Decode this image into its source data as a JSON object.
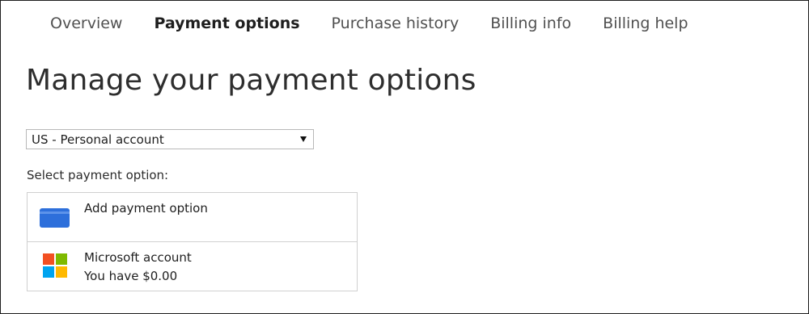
{
  "nav": {
    "tabs": [
      {
        "label": "Overview",
        "active": false
      },
      {
        "label": "Payment options",
        "active": true
      },
      {
        "label": "Purchase history",
        "active": false
      },
      {
        "label": "Billing info",
        "active": false
      },
      {
        "label": "Billing help",
        "active": false
      }
    ]
  },
  "page": {
    "title": "Manage your payment options"
  },
  "account_select": {
    "value": "US - Personal account",
    "icon": "chevron-down-icon"
  },
  "payment": {
    "section_label": "Select payment option:",
    "options": [
      {
        "label": "Add payment option",
        "icon": "credit-card-icon",
        "color": "#2d6fdb"
      },
      {
        "label": "Microsoft account",
        "sub": "You have $0.00",
        "icon": "microsoft-logo-icon"
      }
    ]
  },
  "colors": {
    "card_blue": "#2d6fdb",
    "ms_red": "#f25022",
    "ms_green": "#7fba00",
    "ms_blue": "#00a4ef",
    "ms_yellow": "#ffb900"
  }
}
